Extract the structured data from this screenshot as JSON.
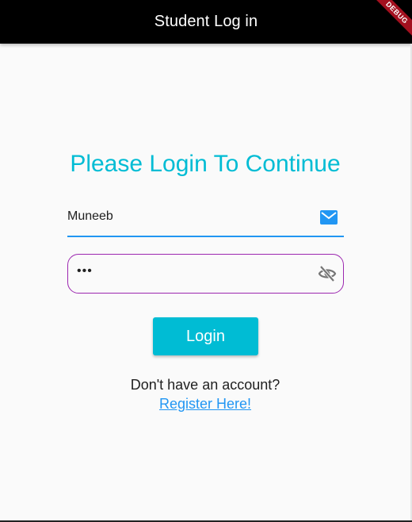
{
  "app_bar": {
    "title": "Student Log in",
    "debug_label": "DEBUG"
  },
  "form": {
    "heading": "Please Login To Continue",
    "email_field": {
      "value": "Muneeb",
      "icon": "mail-icon"
    },
    "password_field": {
      "value": "•••",
      "icon": "visibility-off-icon"
    },
    "login_button_label": "Login",
    "no_account_text": "Don't have an account?",
    "register_link_label": "Register Here!"
  },
  "colors": {
    "app_bar": "#000000",
    "accent": "#00bcd4",
    "email_underline": "#2196f3",
    "password_border": "#9c27b0",
    "link": "#2196f3",
    "debug_banner": "#a3101f"
  }
}
